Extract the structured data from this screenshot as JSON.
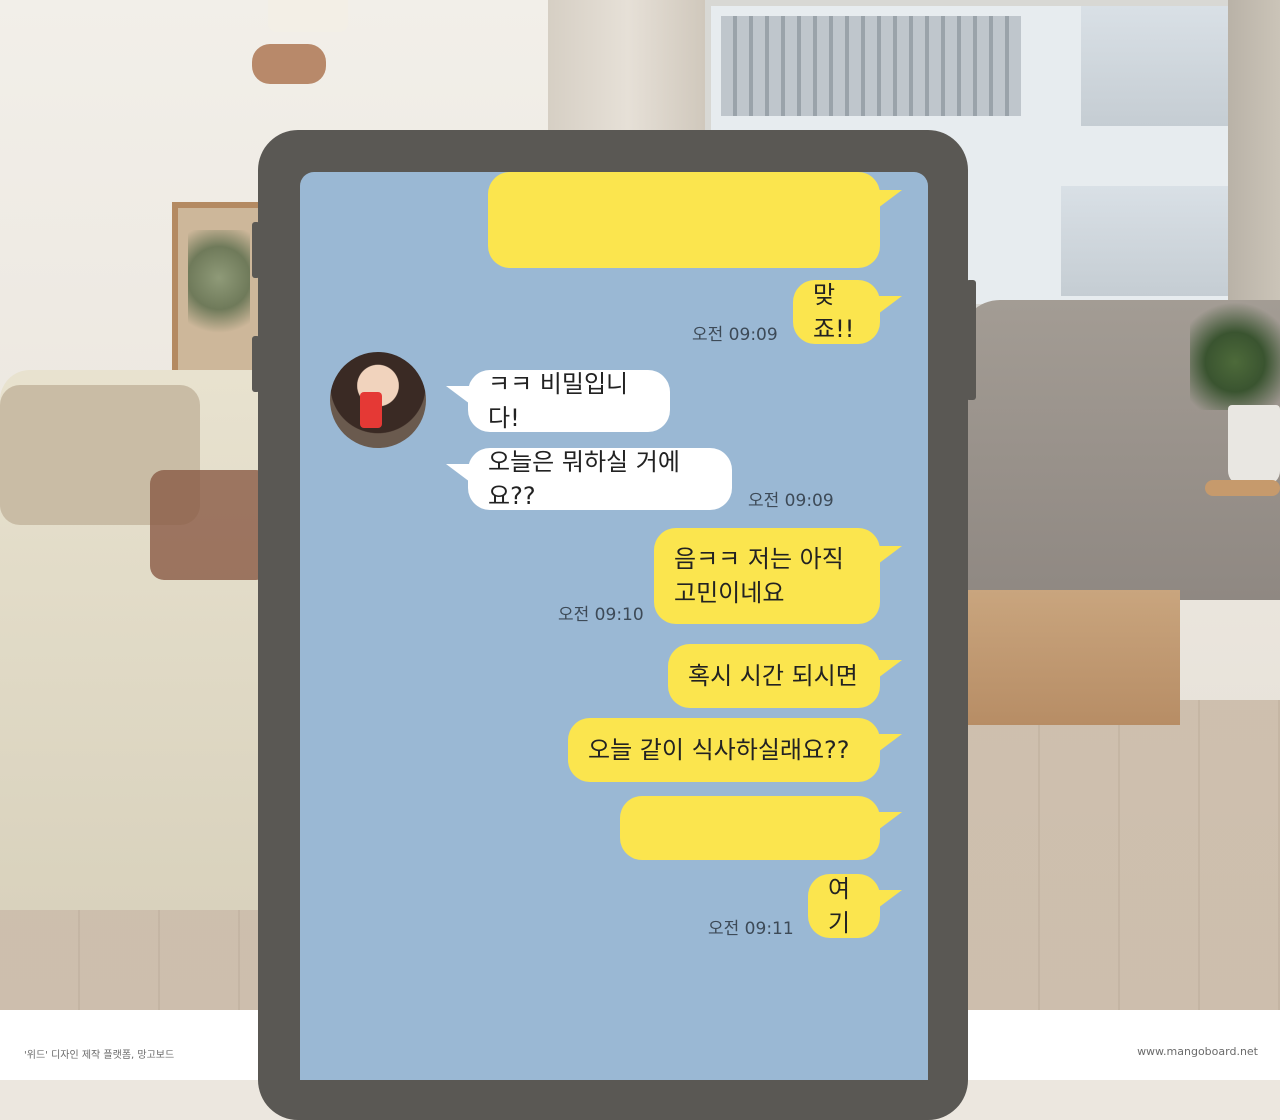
{
  "footer": {
    "credit_left": "'위드' 디자인 제작 플랫폼, 망고보드",
    "credit_right": "www.mangoboard.net"
  },
  "chat": {
    "messages": [
      {
        "sender": "me",
        "text": ""
      },
      {
        "sender": "me",
        "text": "맞죠!!",
        "time": "오전 09:09"
      },
      {
        "sender": "other",
        "text": "ㅋㅋ 비밀입니다!"
      },
      {
        "sender": "other",
        "text": "오늘은 뭐하실 거에요??",
        "time": "오전 09:09"
      },
      {
        "sender": "me",
        "line1": "음ㅋㅋ 저는 아직",
        "line2": "고민이네요",
        "time": "오전 09:10"
      },
      {
        "sender": "me",
        "text": "혹시 시간 되시면"
      },
      {
        "sender": "me",
        "text": "오늘 같이 식사하실래요??"
      },
      {
        "sender": "me",
        "text": ""
      },
      {
        "sender": "me",
        "text": "여기",
        "time": "오전 09:11"
      }
    ]
  },
  "colors": {
    "chat_bg": "#9ab8d4",
    "my_bubble": "#fbe54e",
    "their_bubble": "#ffffff",
    "phone_frame": "#5a5854"
  }
}
